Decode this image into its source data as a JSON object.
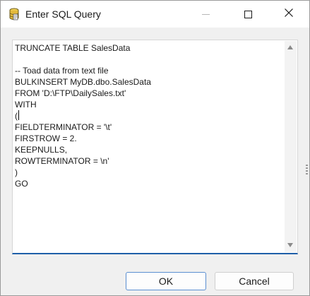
{
  "window": {
    "title": "Enter SQL Query",
    "app_icon": "database-icon",
    "controls": [
      "minimize-icon",
      "maximize-icon",
      "close-icon"
    ]
  },
  "editor": {
    "lines": [
      "TRUNCATE TABLE SalesData",
      "",
      "-- Toad data from text file",
      "BULKINSERT MyDB.dbo.SalesData",
      "FROM 'D:\\FTP\\DailySales.txt'",
      "WITH",
      "(",
      "FIELDTERMINATOR = '\\t'",
      "FIRSTROW = 2.",
      "KEEPNULLS,",
      "ROWTERMINATOR = \\n'",
      ")",
      "GO"
    ]
  },
  "buttons": {
    "ok_label": "OK",
    "cancel_label": "Cancel"
  },
  "colors": {
    "focus_underline": "#1f5fa8",
    "default_button_border": "#5b8fd1",
    "titlebar": "#ffffff",
    "dialog_background": "#f0f0f0"
  }
}
